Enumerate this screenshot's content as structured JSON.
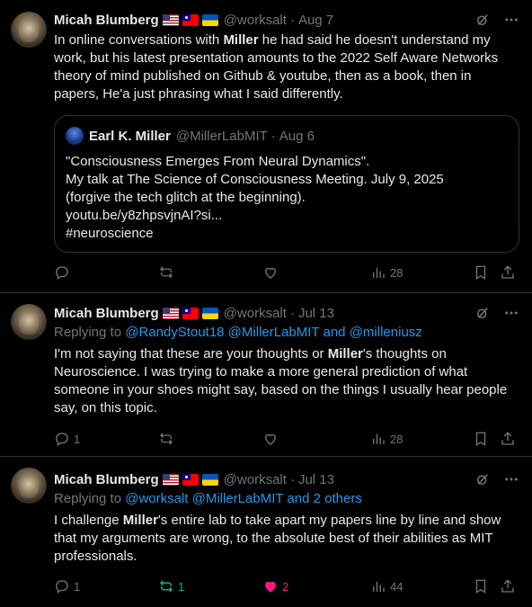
{
  "posts": [
    {
      "author_name": "Micah Blumberg",
      "handle": "@worksalt",
      "time": "Aug 7",
      "text_pre": "In online conversations with ",
      "text_bold": "Miller",
      "text_post": " he had said he doesn't understand my work, but his latest presentation amounts to the 2022 Self Aware Networks theory of mind published on Github & youtube, then as a book, then in papers, He'a just phrasing what I said differently.",
      "quote": {
        "author_name": "Earl K. Miller",
        "handle": "@MillerLabMIT",
        "time": "Aug 6",
        "lines": [
          "\"Consciousness Emerges From Neural Dynamics\".",
          "My talk at The Science of Consciousness Meeting. July 9, 2025",
          "(forgive the tech glitch at the beginning).",
          "youtu.be/y8zhpsvjnAI?si...",
          "#neuroscience"
        ]
      },
      "actions": {
        "replies": "",
        "reposts": "",
        "likes": "",
        "views": "28"
      }
    },
    {
      "author_name": "Micah Blumberg",
      "handle": "@worksalt",
      "time": "Jul 13",
      "replying_label": "Replying to ",
      "replying_links": "@RandyStout18 @MillerLabMIT",
      "replying_and": " and ",
      "replying_more": "@milleniusz",
      "text_pre": "I'm not saying that these are your thoughts or ",
      "text_bold": "Miller",
      "text_post": "'s thoughts on Neuroscience. I was trying to make a more general prediction of what someone in your shoes might say, based on the things I usually hear people say, on this topic.",
      "actions": {
        "replies": "1",
        "reposts": "",
        "likes": "",
        "views": "28"
      }
    },
    {
      "author_name": "Micah Blumberg",
      "handle": "@worksalt",
      "time": "Jul 13",
      "replying_label": "Replying to ",
      "replying_links": "@worksalt @MillerLabMIT",
      "replying_and": " and ",
      "replying_more": "2 others",
      "text_pre": "I challenge ",
      "text_bold": "Miller",
      "text_post": "'s entire lab to take apart my papers line by line and show that my arguments are wrong, to the absolute best of their abilities as MIT professionals.",
      "actions": {
        "replies": "1",
        "reposts": "1",
        "likes": "2",
        "views": "44"
      }
    }
  ],
  "colors": {
    "background": "#000000",
    "text": "#e7e9ea",
    "muted": "#71767b",
    "link": "#1d9bf0",
    "repost_active": "#00ba7c",
    "like_active": "#f91880",
    "border": "#2f3336"
  },
  "icons": [
    "grok-icon",
    "more-icon",
    "reply-icon",
    "repost-icon",
    "like-icon",
    "views-icon",
    "bookmark-icon",
    "share-icon"
  ]
}
